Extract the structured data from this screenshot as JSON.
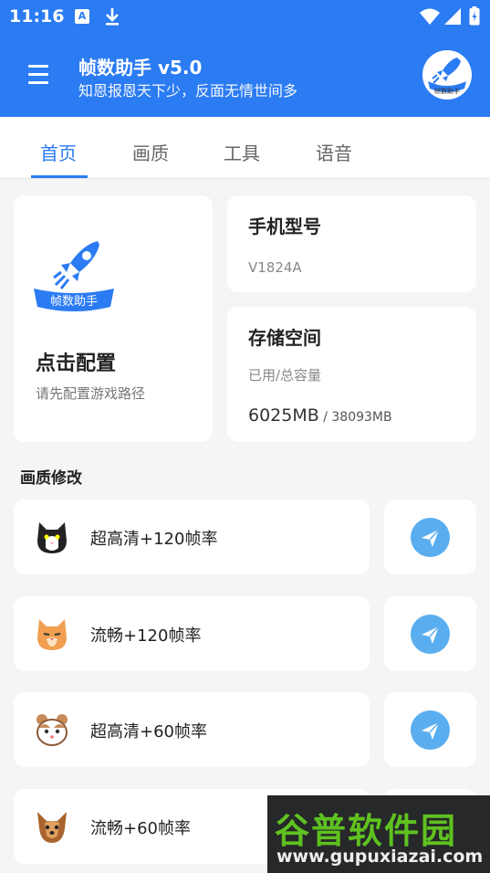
{
  "status_bar": {
    "time": "11:16",
    "a_badge": "A"
  },
  "header": {
    "title": "帧数助手 v5.0",
    "subtitle": "知恩报恩天下少，反面无情世间多",
    "logo_text": "帧数助手"
  },
  "tabs": [
    {
      "label": "首页",
      "active": true
    },
    {
      "label": "画质",
      "active": false
    },
    {
      "label": "工具",
      "active": false
    },
    {
      "label": "语音",
      "active": false
    }
  ],
  "config_card": {
    "logo_text": "帧数助手",
    "title": "点击配置",
    "subtitle": "请先配置游戏路径"
  },
  "model_card": {
    "title": "手机型号",
    "value": "V1824A"
  },
  "storage_card": {
    "title": "存储空间",
    "label": "已用/总容量",
    "used": "6025MB",
    "total": " / 38093MB"
  },
  "section": {
    "title": "画质修改"
  },
  "presets": [
    {
      "label": "超高清+120帧率",
      "avatar": "black-white-cat-icon"
    },
    {
      "label": "流畅+120帧率",
      "avatar": "orange-cat-icon"
    },
    {
      "label": "超高清+60帧率",
      "avatar": "hamster-icon"
    },
    {
      "label": "流畅+60帧率",
      "avatar": "yorkie-dog-icon"
    }
  ],
  "watermark": {
    "top": "谷普软件园",
    "bottom": "www.gupuxiazai.com"
  },
  "colors": {
    "primary": "#2b7bf3",
    "send_button": "#5aaef0",
    "background": "#f5f5f5"
  }
}
